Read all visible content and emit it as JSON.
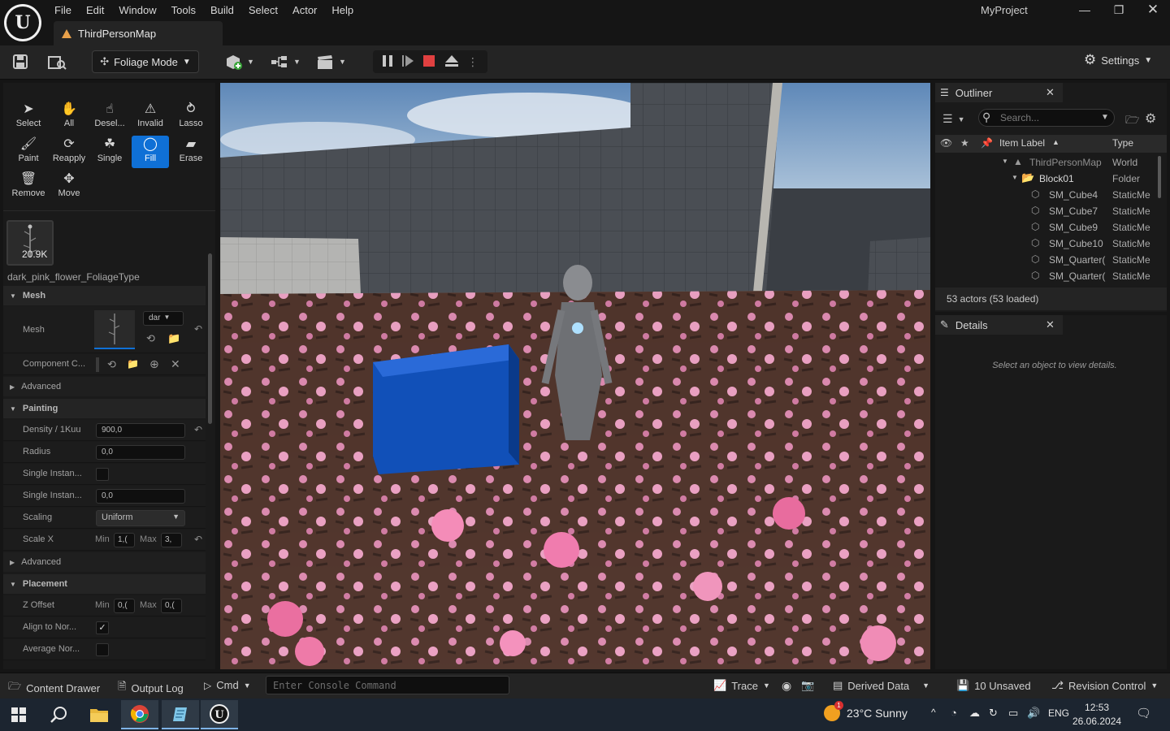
{
  "app": {
    "menu": [
      "File",
      "Edit",
      "Window",
      "Tools",
      "Build",
      "Select",
      "Actor",
      "Help"
    ],
    "project_name": "MyProject",
    "map_tab": "ThirdPersonMap"
  },
  "toolbar": {
    "mode": "Foliage Mode",
    "settings": "Settings"
  },
  "foliage_tools": [
    {
      "label": "Select",
      "icon": "cursor-icon"
    },
    {
      "label": "All",
      "icon": "select-all-icon"
    },
    {
      "label": "Desel...",
      "icon": "deselect-icon"
    },
    {
      "label": "Invalid",
      "icon": "invalid-icon"
    },
    {
      "label": "Lasso",
      "icon": "lasso-icon"
    },
    {
      "label": "Paint",
      "icon": "brush-icon"
    },
    {
      "label": "Reapply",
      "icon": "reapply-icon"
    },
    {
      "label": "Single",
      "icon": "single-plant-icon"
    },
    {
      "label": "Fill",
      "icon": "fill-bucket-icon"
    },
    {
      "label": "Erase",
      "icon": "eraser-icon"
    },
    {
      "label": "Remove",
      "icon": "trash-icon"
    },
    {
      "label": "Move",
      "icon": "move-icon"
    }
  ],
  "active_tool": "Fill",
  "foliage": {
    "instance_count": "20.9K",
    "name": "dark_pink_flower_FoliageType"
  },
  "details_left": {
    "mesh_section": "Mesh",
    "mesh_label": "Mesh",
    "mesh_dropdown": "dar",
    "component_label": "Component C...",
    "advanced_1": "Advanced",
    "painting_section": "Painting",
    "density_label": "Density / 1Kuu",
    "density_value": "900,0",
    "radius_label": "Radius",
    "radius_value": "0,0",
    "single_inst_1_label": "Single Instan...",
    "single_inst_2_label": "Single Instan...",
    "single_inst_2_value": "0,0",
    "scaling_label": "Scaling",
    "scaling_value": "Uniform",
    "scalex_label": "Scale X",
    "min_label": "Min",
    "max_label": "Max",
    "scalex_min": "1,(",
    "scalex_max": "3,",
    "advanced_2": "Advanced",
    "placement_section": "Placement",
    "zoffset_label": "Z Offset",
    "zoffset_min": "0,(",
    "zoffset_max": "0,(",
    "align_label": "Align to Nor...",
    "average_label": "Average Nor..."
  },
  "outliner": {
    "title": "Outliner",
    "search_placeholder": "Search...",
    "col_label": "Item Label",
    "col_type": "Type",
    "rows": [
      {
        "name": "ThirdPersonMap",
        "type": "World"
      },
      {
        "name": "Block01",
        "type": "Folder"
      },
      {
        "name": "SM_Cube4",
        "type": "StaticMe"
      },
      {
        "name": "SM_Cube7",
        "type": "StaticMe"
      },
      {
        "name": "SM_Cube9",
        "type": "StaticMe"
      },
      {
        "name": "SM_Cube10",
        "type": "StaticMe"
      },
      {
        "name": "SM_Quarter(",
        "type": "StaticMe"
      },
      {
        "name": "SM_Quarter(",
        "type": "StaticMe"
      }
    ],
    "actor_count": "53 actors (53 loaded)"
  },
  "details": {
    "title": "Details",
    "empty_msg": "Select an object to view details."
  },
  "statusbar": {
    "content_drawer": "Content Drawer",
    "output_log": "Output Log",
    "cmd": "Cmd",
    "console_placeholder": "Enter Console Command",
    "trace": "Trace",
    "derived_data": "Derived Data",
    "unsaved": "10 Unsaved",
    "revision": "Revision Control"
  },
  "taskbar": {
    "weather": "23°C  Sunny",
    "weather_badge": "1",
    "lang": "ENG",
    "time": "12:53",
    "date": "26.06.2024"
  },
  "colors": {
    "accent": "#0f70d6",
    "panel": "#1a1a1a",
    "toolbar": "#242424",
    "stop_red": "#e04040"
  }
}
